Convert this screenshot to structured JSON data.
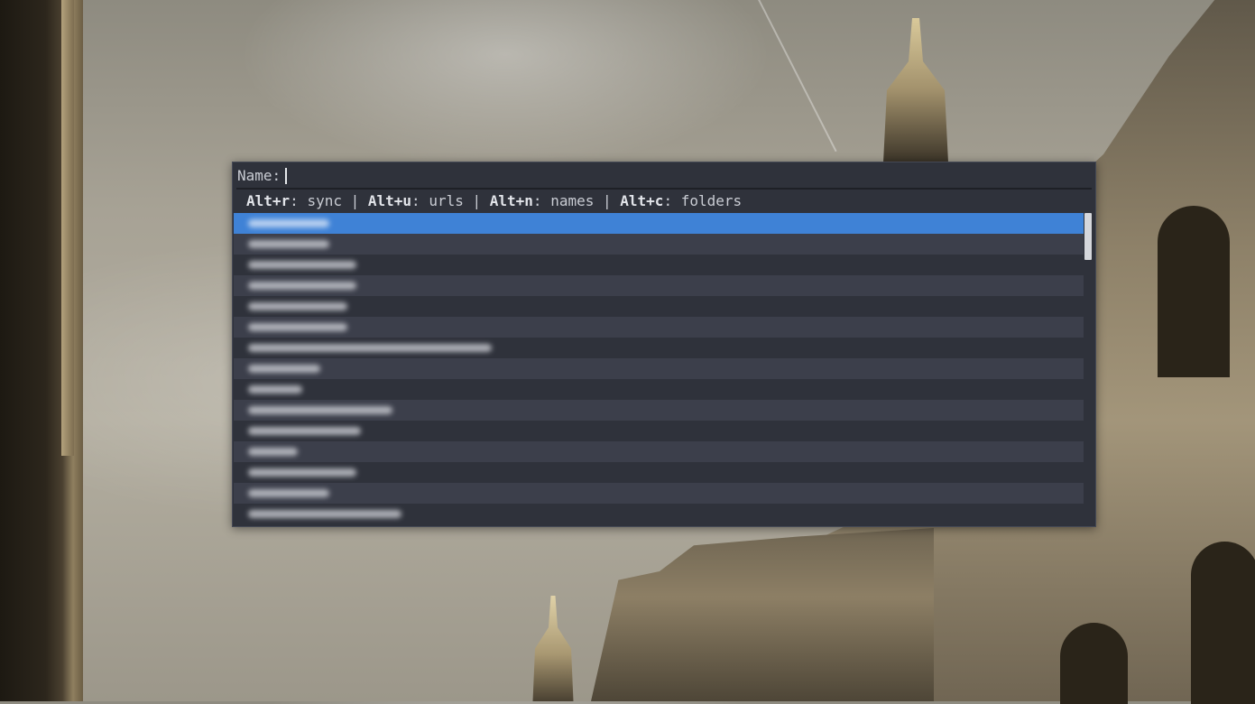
{
  "dialog": {
    "prompt_label": "Name:",
    "input_value": "",
    "hints": [
      {
        "key": "Alt+r",
        "action": "sync"
      },
      {
        "key": "Alt+u",
        "action": "urls"
      },
      {
        "key": "Alt+n",
        "action": "names"
      },
      {
        "key": "Alt+c",
        "action": "folders"
      }
    ],
    "hint_separator": " | ",
    "selected_index": 0,
    "scroll_position": 0.0
  },
  "colors": {
    "dialog_bg": "#2f323b",
    "row_alt_bg": "#3c3f4b",
    "selection": "#3f82d6",
    "text": "#d3d7de"
  }
}
